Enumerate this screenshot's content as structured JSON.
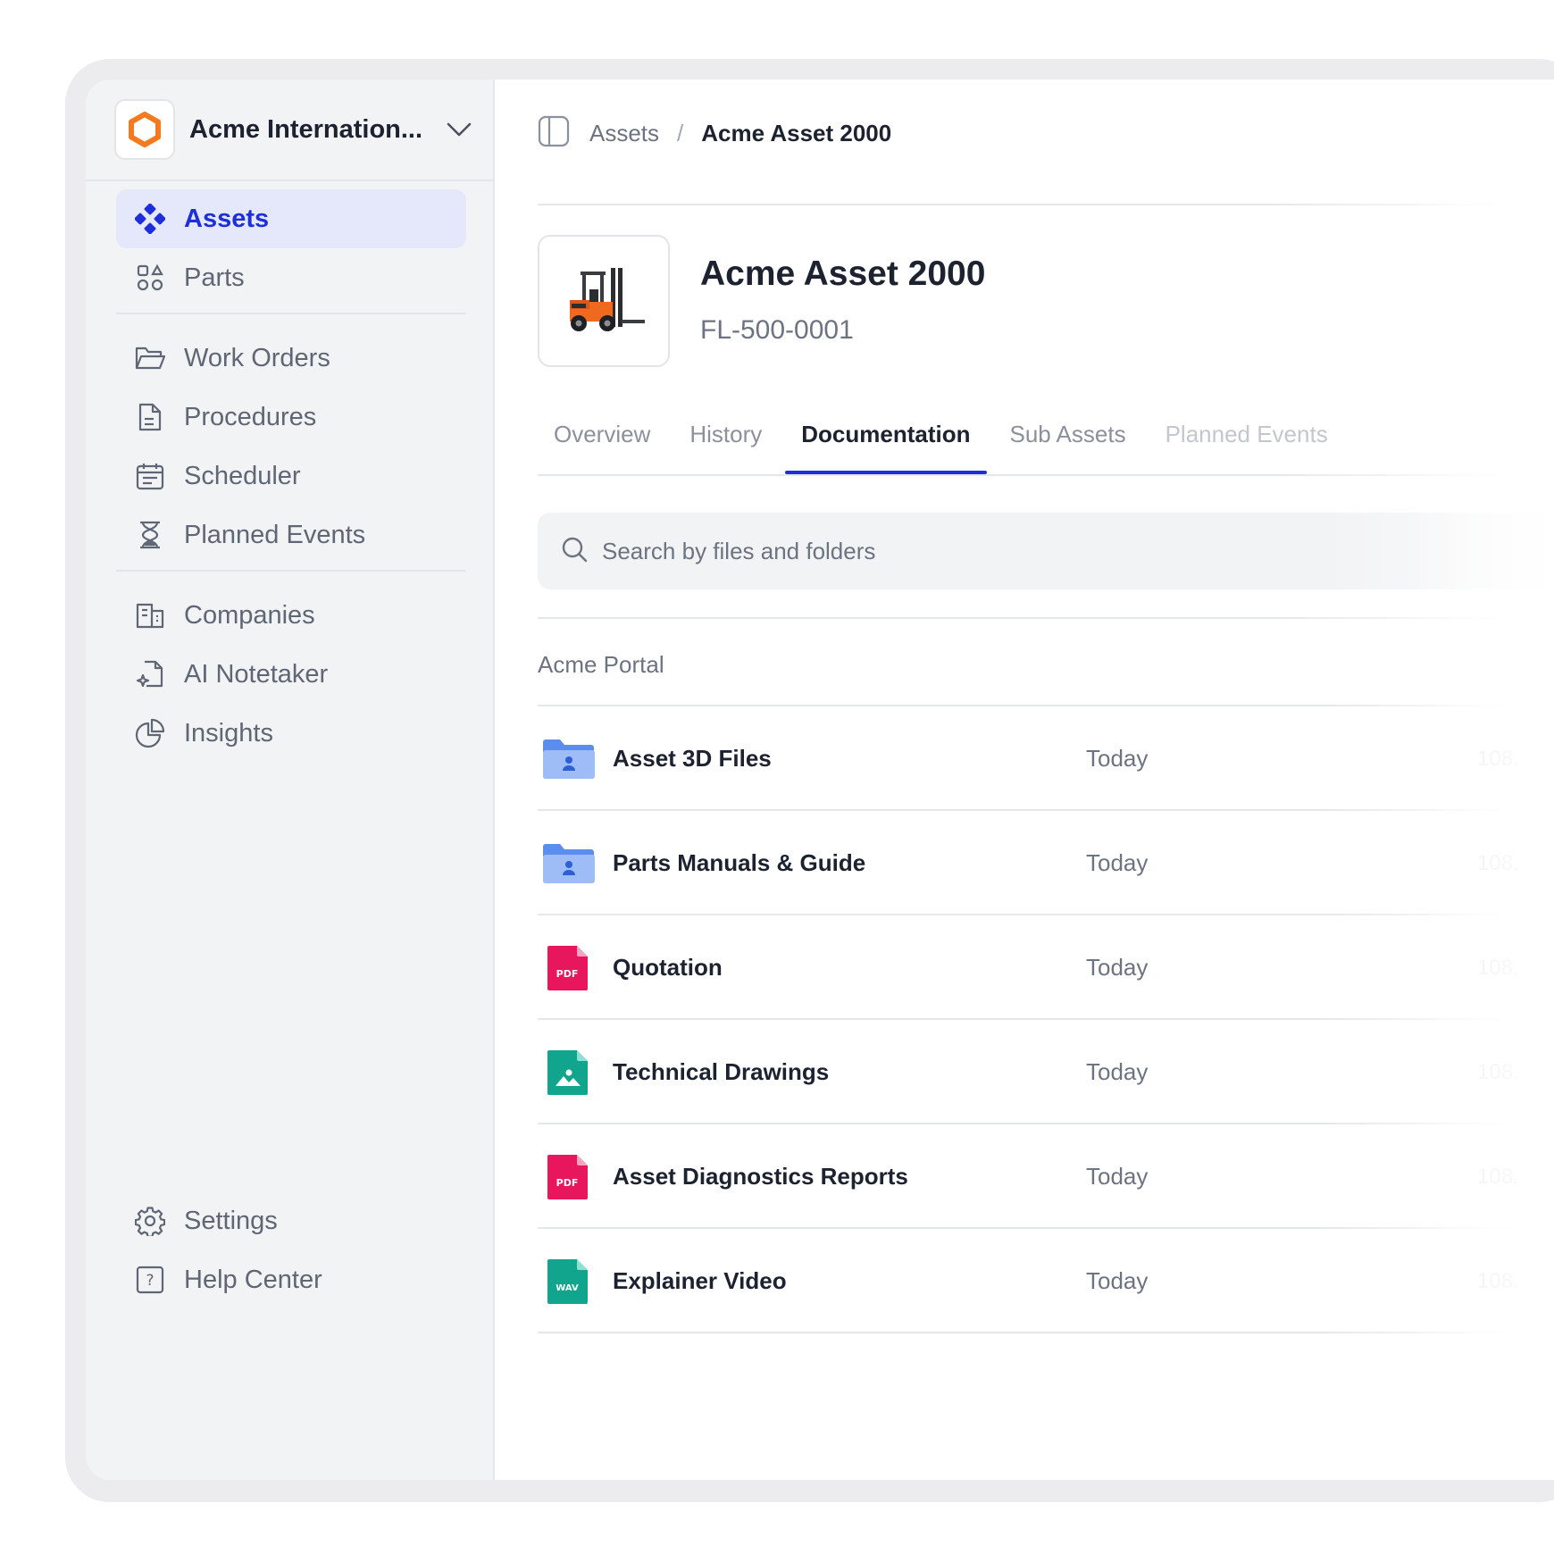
{
  "org": {
    "name": "Acme Internation..."
  },
  "nav": {
    "primary": [
      {
        "label": "Assets",
        "icon": "assets-icon",
        "active": true
      },
      {
        "label": "Parts",
        "icon": "parts-icon"
      }
    ],
    "work": [
      {
        "label": "Work Orders",
        "icon": "folder-icon"
      },
      {
        "label": "Procedures",
        "icon": "document-icon"
      },
      {
        "label": "Scheduler",
        "icon": "calendar-icon"
      },
      {
        "label": "Planned Events",
        "icon": "hourglass-icon"
      }
    ],
    "tools": [
      {
        "label": "Companies",
        "icon": "building-icon"
      },
      {
        "label": "AI Notetaker",
        "icon": "notetaker-icon"
      },
      {
        "label": "Insights",
        "icon": "pie-chart-icon"
      }
    ],
    "footer": [
      {
        "label": "Settings",
        "icon": "gear-icon"
      },
      {
        "label": "Help Center",
        "icon": "help-icon"
      }
    ]
  },
  "breadcrumb": {
    "parent": "Assets",
    "separator": "/",
    "current": "Acme Asset 2000"
  },
  "asset": {
    "title": "Acme Asset 2000",
    "code": "FL-500-0001"
  },
  "tabs": [
    "Overview",
    "History",
    "Documentation",
    "Sub Assets",
    "Planned Events"
  ],
  "active_tab": "Documentation",
  "search": {
    "placeholder": "Search by files and folders"
  },
  "section_label": "Acme Portal",
  "files": [
    {
      "name": "Asset 3D Files",
      "date": "Today",
      "size": "108.",
      "type": "folder"
    },
    {
      "name": "Parts Manuals & Guide",
      "date": "Today",
      "size": "108.",
      "type": "folder"
    },
    {
      "name": "Quotation",
      "date": "Today",
      "size": "108.",
      "type": "pdf",
      "badge": "PDF"
    },
    {
      "name": "Technical Drawings",
      "date": "Today",
      "size": "108.",
      "type": "image"
    },
    {
      "name": "Asset Diagnostics Reports",
      "date": "Today",
      "size": "108.",
      "type": "pdf",
      "badge": "PDF"
    },
    {
      "name": "Explainer Video",
      "date": "Today",
      "size": "108.",
      "type": "wav",
      "badge": "WAV"
    }
  ],
  "colors": {
    "accent": "#1e2ed8",
    "brand_orange": "#f47a1f",
    "pdf": "#e8175d",
    "teal": "#12a58d",
    "folder": "#5b8def"
  }
}
